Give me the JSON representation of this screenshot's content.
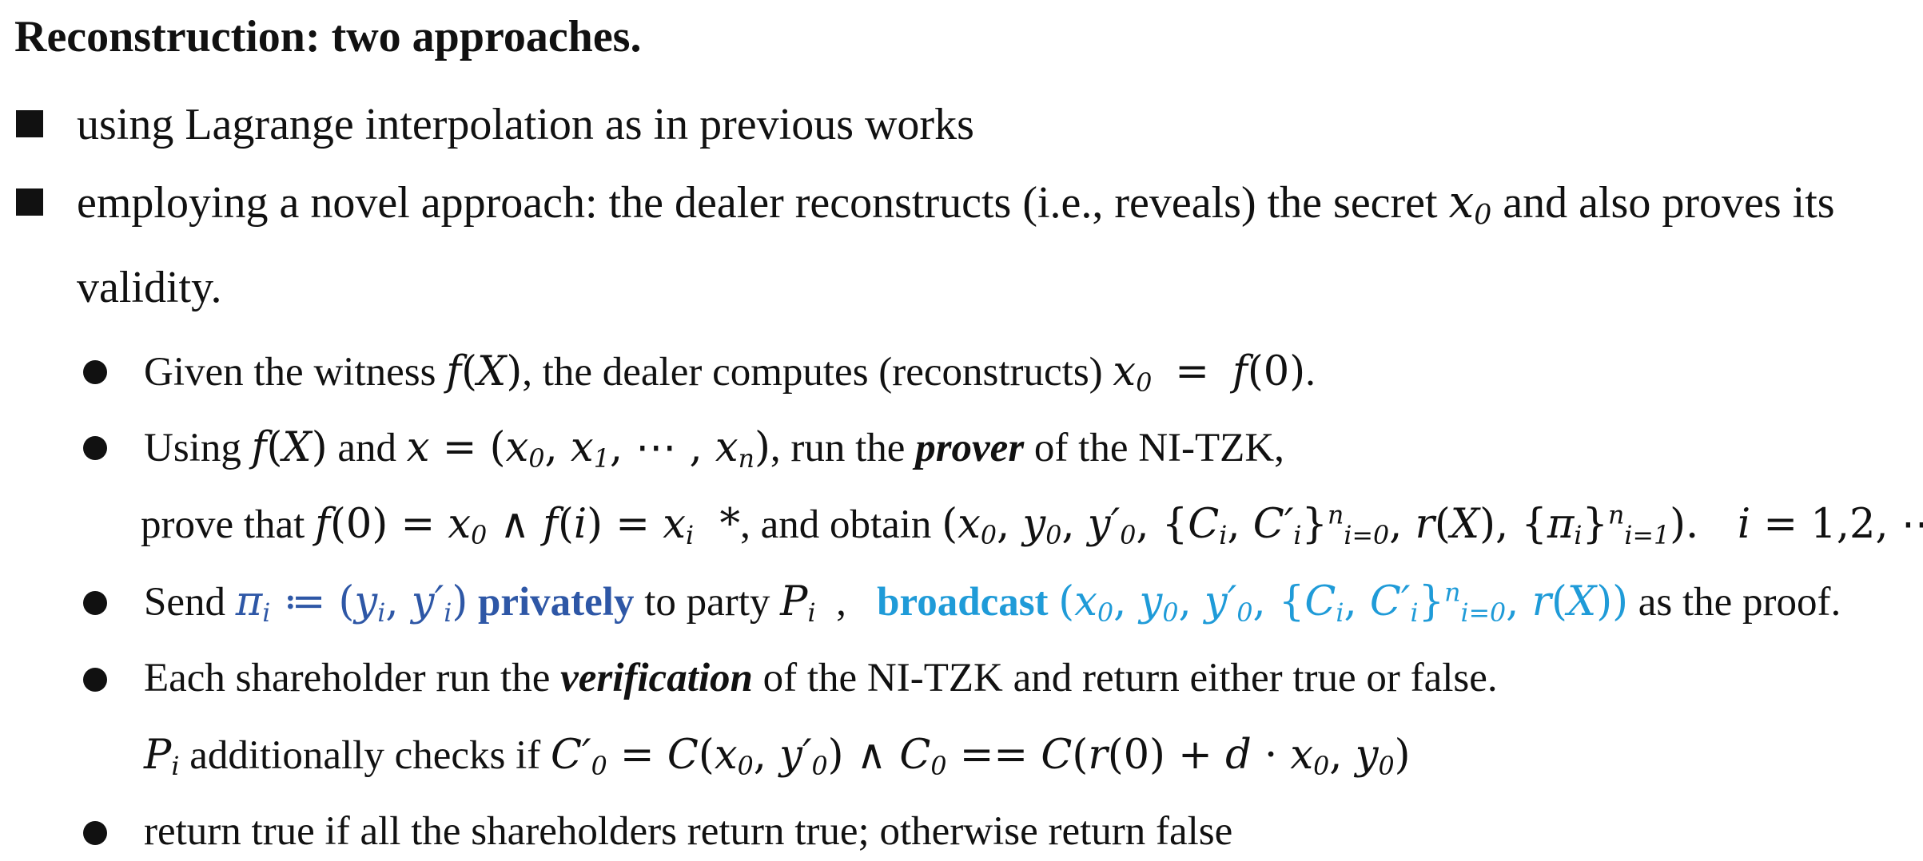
{
  "title": "Reconstruction: two approaches.",
  "approaches": [
    {
      "text": "using Lagrange interpolation as in previous works"
    },
    {
      "line1_prefix": "employing a novel approach: the dealer reconstructs (i.e., reveals) the secret",
      "line1_suffix": "and also proves its",
      "line2": "validity."
    }
  ],
  "steps": {
    "s1_prefix": "Given the witness",
    "s1_mid": ", the dealer computes (reconstructs)",
    "s1_end": ".",
    "s2_prefix": "Using",
    "s2_and": "and",
    "s2_run": ", run the",
    "s2_prover": "prover",
    "s2_suffix": "of the NI-TZK,",
    "s2b_prefix": "prove that",
    "s2b_mid": ", and obtain",
    "s3_send": "Send",
    "s3_privately": "privately",
    "s3_toparty": "to party",
    "s3_broadcast": "broadcast",
    "s3_suffix": "as the proof.",
    "s4_prefix": "Each shareholder run the",
    "s4_verification": "verification",
    "s4_suffix": "of the NI-TZK and return either true or false.",
    "s4b_mid": "additionally checks if",
    "s5": "return true if all the shareholders return true; otherwise return false"
  },
  "colors": {
    "private_blue": "#2e57a6",
    "broadcast_cyan": "#1f9bd8",
    "text": "#111111"
  }
}
